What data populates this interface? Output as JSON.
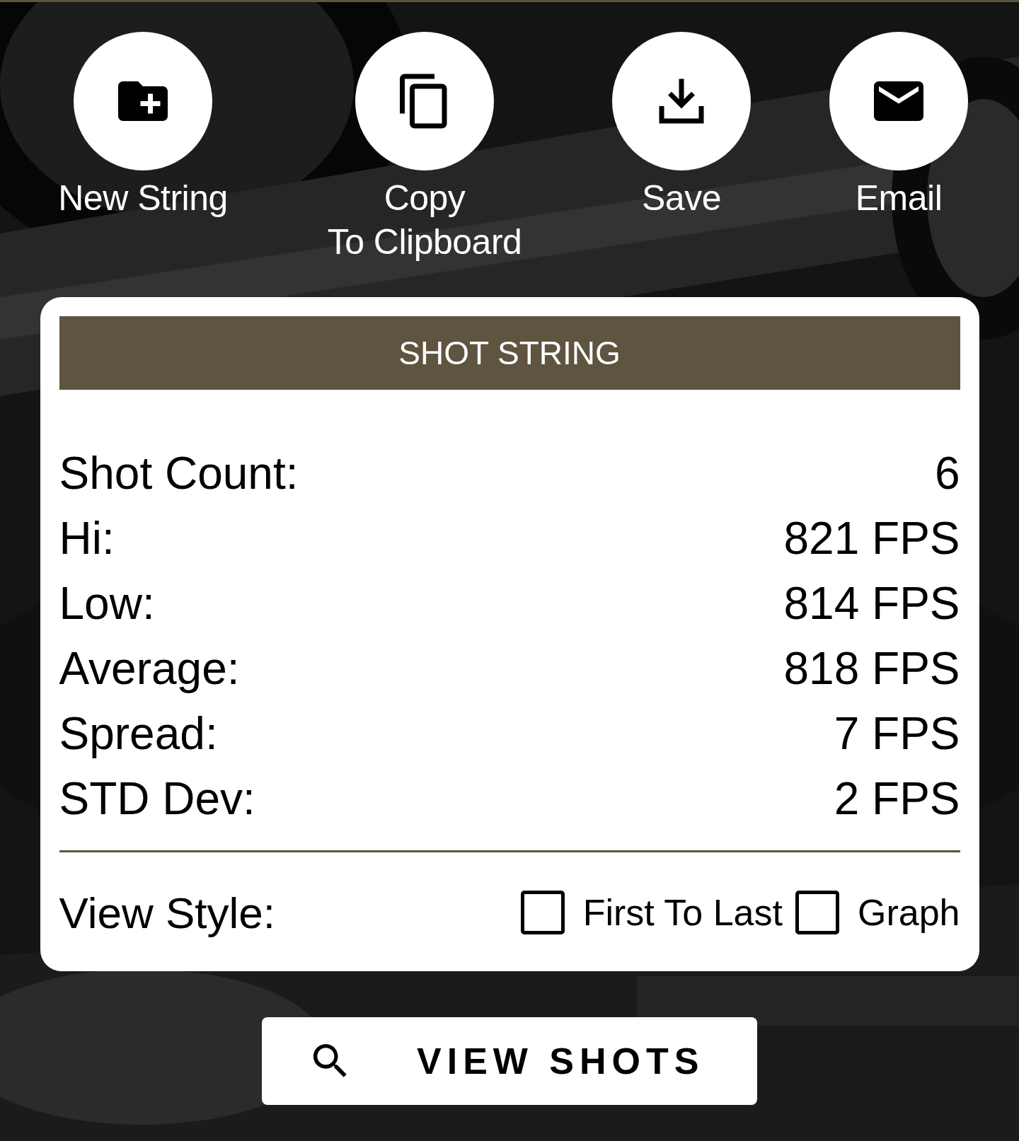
{
  "actions": [
    {
      "kind": "new-folder",
      "label": "New String"
    },
    {
      "kind": "copy",
      "label": "Copy\nTo Clipboard"
    },
    {
      "kind": "download",
      "label": "Save"
    },
    {
      "kind": "email",
      "label": "Email"
    }
  ],
  "card": {
    "title": "SHOT STRING",
    "stats": [
      {
        "label": "Shot Count:",
        "value": "6"
      },
      {
        "label": "Hi:",
        "value": "821 FPS"
      },
      {
        "label": "Low:",
        "value": "814 FPS"
      },
      {
        "label": "Average:",
        "value": "818 FPS"
      },
      {
        "label": "Spread:",
        "value": "7 FPS"
      },
      {
        "label": "STD Dev:",
        "value": "2 FPS"
      }
    ],
    "view_style": {
      "label": "View Style:",
      "options": [
        {
          "label": "First To Last",
          "checked": false
        },
        {
          "label": "Graph",
          "checked": false
        }
      ]
    }
  },
  "button": {
    "label": "VIEW SHOTS"
  }
}
